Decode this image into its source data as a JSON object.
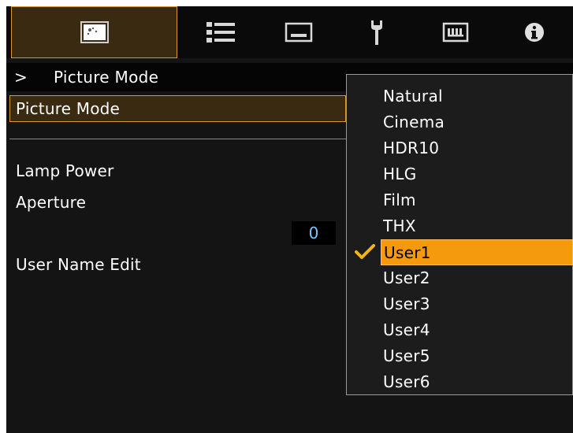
{
  "tabs": [
    {
      "icon": "picture-icon",
      "active": true
    },
    {
      "icon": "settings-list-icon",
      "active": false
    },
    {
      "icon": "display-icon",
      "active": false
    },
    {
      "icon": "wrench-icon",
      "active": false
    },
    {
      "icon": "input-icon",
      "active": false
    },
    {
      "icon": "info-icon",
      "active": false
    }
  ],
  "breadcrumb": {
    "arrow": ">",
    "title": "Picture Mode"
  },
  "menu": {
    "picture_mode_label": "Picture Mode",
    "lamp_power_label": "Lamp Power",
    "aperture_label": "Aperture",
    "aperture_value": "0",
    "user_name_edit_label": "User Name Edit"
  },
  "dropdown": {
    "options": [
      "Natural",
      "Cinema",
      "HDR10",
      "HLG",
      "Film",
      "THX",
      "User1",
      "User2",
      "User3",
      "User4",
      "User5",
      "User6"
    ],
    "selected": "User1"
  },
  "colors": {
    "accent": "#d8982c",
    "selection": "#f59a0c",
    "value_text": "#7cc4ff"
  }
}
